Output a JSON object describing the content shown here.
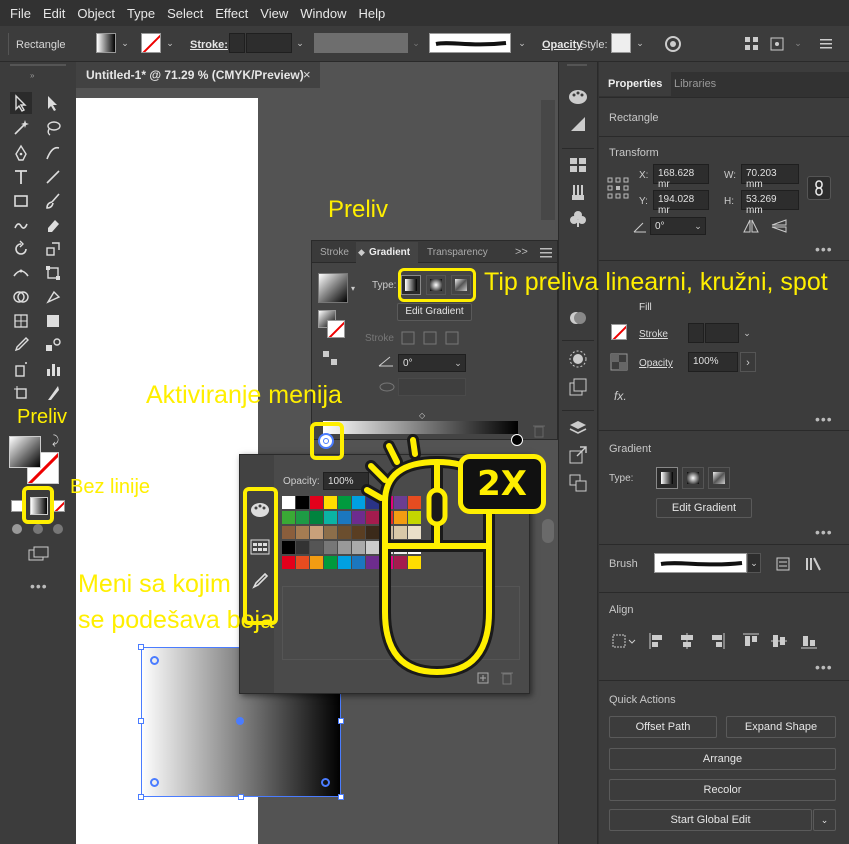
{
  "menu": [
    "File",
    "Edit",
    "Object",
    "Type",
    "Select",
    "Effect",
    "View",
    "Window",
    "Help"
  ],
  "control_bar": {
    "object_type": "Rectangle",
    "stroke_label": "Stroke:",
    "opacity_label": "Opacity",
    "style_label": "Style:"
  },
  "document_tab": {
    "title": "Untitled-1* @ 71.29 % (CMYK/Preview)",
    "close": "×"
  },
  "gradient_panel": {
    "tabs": [
      "Stroke",
      "Gradient",
      "Transparency"
    ],
    "type_label": "Type:",
    "edit_gradient": "Edit Gradient",
    "stroke_label": "Stroke",
    "angle": "0°",
    "collapse": ">>"
  },
  "swatch_panel": {
    "opacity_label": "Opacity:",
    "opacity_value": "100%"
  },
  "properties_panel": {
    "tabs": [
      "Properties",
      "Libraries"
    ],
    "object": "Rectangle",
    "transform": {
      "title": "Transform",
      "x_label": "X:",
      "x": "168.628 mr",
      "y_label": "Y:",
      "y": "194.028 mr",
      "w_label": "W:",
      "w": "70.203 mm",
      "h_label": "H:",
      "h": "53.269 mm",
      "angle": "0°"
    },
    "appearance": {
      "fill": "Fill",
      "stroke": "Stroke",
      "opacity": "Opacity",
      "opacity_value": "100%",
      "fx": "fx."
    },
    "gradient": {
      "title": "Gradient",
      "type_label": "Type:",
      "edit_gradient": "Edit Gradient"
    },
    "brush": {
      "label": "Brush"
    },
    "align": {
      "title": "Align"
    },
    "quick_actions": {
      "title": "Quick Actions",
      "offset_path": "Offset Path",
      "expand_shape": "Expand Shape",
      "arrange": "Arrange",
      "recolor": "Recolor",
      "start_global_edit": "Start Global Edit"
    }
  },
  "annotations": {
    "preliv_top": "Preliv",
    "tip_preliva": "Tip preliva linearni, kružni, spot",
    "aktiviranje": "Aktiviranje menija",
    "preliv_left": "Preliv",
    "bez_linije": "Bez linije",
    "meni_line1": "Meni sa kojim",
    "meni_line2": "se podešava boja",
    "double_click": "2X"
  },
  "colors": {
    "highlight": "#ffef00",
    "panel_bg": "#3c3c3c",
    "canvas_bg": "#535353",
    "selection": "#4a7cff"
  }
}
